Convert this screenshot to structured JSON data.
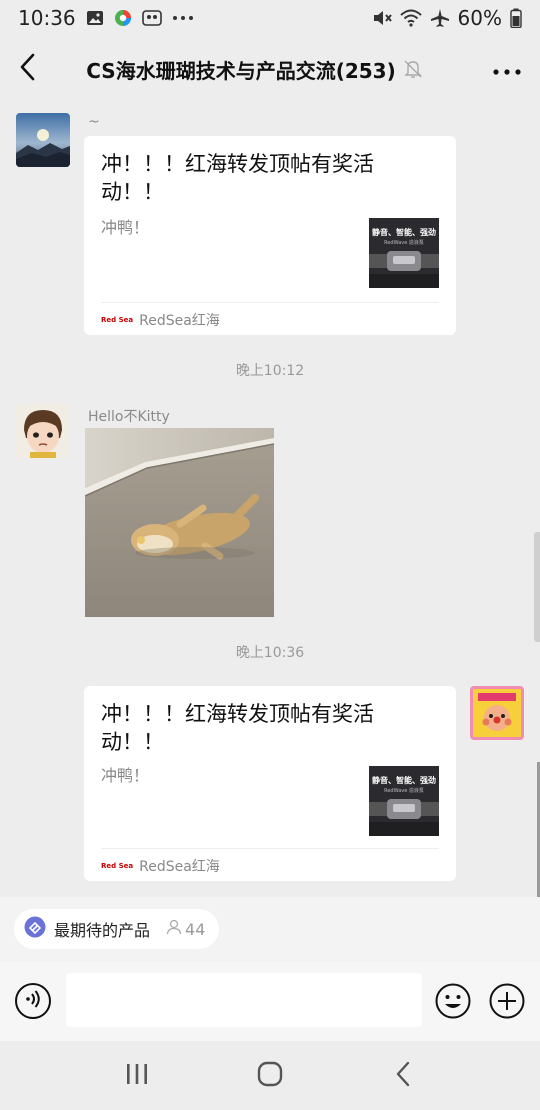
{
  "status_bar": {
    "time": "10:36",
    "battery": "60%"
  },
  "header": {
    "title": "CS海水珊瑚技术与产品交流(253)"
  },
  "messages": {
    "m1": {
      "sender": "~",
      "title": "冲！！！红海转发顶帖有奖活动！！",
      "desc": "冲鸭！",
      "thumb_headline": "静音、智能、强劲",
      "thumb_sub": "RedWave 造浪泵",
      "source": "RedSea红海",
      "logo_text": "Red Sea"
    },
    "time1": "晚上10:12",
    "m2": {
      "sender": "Hello不Kitty"
    },
    "time2": "晚上10:36",
    "m3": {
      "title": "冲！！！红海转发顶帖有奖活动！！",
      "desc": "冲鸭！",
      "thumb_headline": "静音、智能、强劲",
      "thumb_sub": "RedWave 造浪泵",
      "source": "RedSea红海",
      "logo_text": "Red Sea"
    }
  },
  "poll": {
    "label": "最期待的产品",
    "count": "44"
  },
  "input": {
    "placeholder": ""
  },
  "icons": {
    "back": "chevron-left-icon",
    "mute": "bell-off-icon",
    "more": "more-dots-icon",
    "voice": "voice-icon",
    "emoji": "emoji-icon",
    "plus": "plus-circle-icon",
    "nav_recents": "recents-icon",
    "nav_home": "home-icon",
    "nav_back": "nav-back-icon"
  },
  "colors": {
    "background": "#ededed",
    "bubble": "#ffffff",
    "poll_accent": "#6b74d6"
  }
}
